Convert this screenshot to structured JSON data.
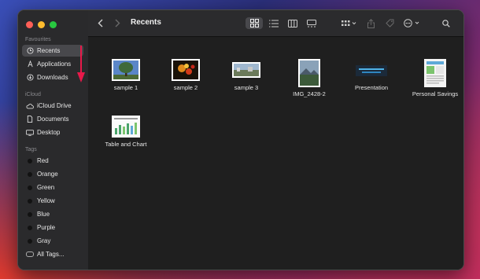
{
  "window": {
    "title": "Recents"
  },
  "sidebar": {
    "sections": {
      "favourites": "Favourites",
      "icloud": "iCloud",
      "tags": "Tags"
    },
    "favourites": [
      {
        "label": "Recents",
        "icon": "clock-icon",
        "selected": true
      },
      {
        "label": "Applications",
        "icon": "applications-icon"
      },
      {
        "label": "Downloads",
        "icon": "download-icon"
      }
    ],
    "icloud": [
      {
        "label": "iCloud Drive",
        "icon": "cloud-icon"
      },
      {
        "label": "Documents",
        "icon": "document-icon"
      },
      {
        "label": "Desktop",
        "icon": "desktop-icon"
      }
    ],
    "tags": [
      {
        "label": "Red"
      },
      {
        "label": "Orange"
      },
      {
        "label": "Green"
      },
      {
        "label": "Yellow"
      },
      {
        "label": "Blue"
      },
      {
        "label": "Purple"
      },
      {
        "label": "Gray"
      },
      {
        "label": "All Tags..."
      }
    ]
  },
  "files": [
    {
      "name": "sample 1",
      "kind": "photo-tree"
    },
    {
      "name": "sample 2",
      "kind": "photo-flowers"
    },
    {
      "name": "sample 3",
      "kind": "photo-landscape"
    },
    {
      "name": "IMG_2428-2",
      "kind": "photo-portrait"
    },
    {
      "name": "Presentation",
      "kind": "presentation"
    },
    {
      "name": "Personal Savings",
      "kind": "spreadsheet"
    },
    {
      "name": "Table and Chart",
      "kind": "chart-doc"
    }
  ],
  "colors": {
    "traffic_close": "#ff5f57",
    "traffic_minimize": "#febc2e",
    "traffic_zoom": "#28c840",
    "annotation_arrow": "#e8194a"
  }
}
